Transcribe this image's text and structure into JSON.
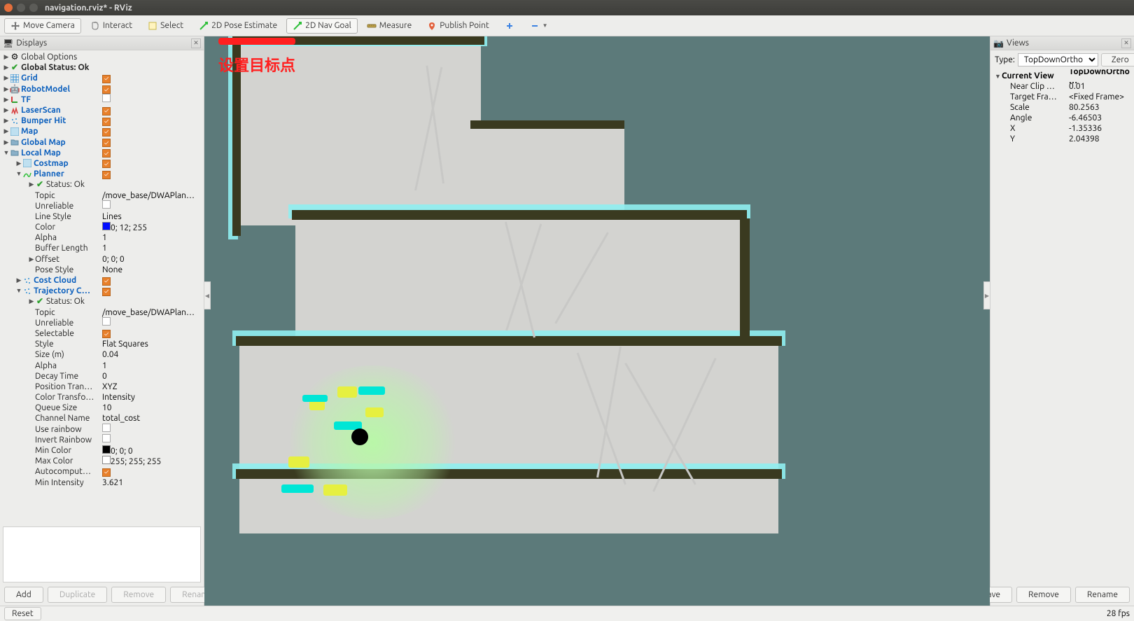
{
  "window": {
    "title": "navigation.rviz* - RViz"
  },
  "toolbar": {
    "move_camera": "Move Camera",
    "interact": "Interact",
    "select": "Select",
    "pose_estimate": "2D Pose Estimate",
    "nav_goal": "2D Nav Goal",
    "measure": "Measure",
    "publish_point": "Publish Point"
  },
  "displays": {
    "title": "Displays",
    "items": {
      "global_options": "Global Options",
      "global_status": "Global Status: Ok",
      "grid": "Grid",
      "robot_model": "RobotModel",
      "tf": "TF",
      "laser_scan": "LaserScan",
      "bumper_hit": "Bumper Hit",
      "map": "Map",
      "global_map": "Global Map",
      "local_map": "Local Map",
      "costmap": "Costmap",
      "planner": "Planner",
      "planner_status": "Status: Ok",
      "planner_topic_k": "Topic",
      "planner_topic_v": "/move_base/DWAPlan…",
      "planner_unreliable_k": "Unreliable",
      "planner_linestyle_k": "Line Style",
      "planner_linestyle_v": "Lines",
      "planner_color_k": "Color",
      "planner_color_v": "0; 12; 255",
      "planner_alpha_k": "Alpha",
      "planner_alpha_v": "1",
      "planner_buflen_k": "Buffer Length",
      "planner_buflen_v": "1",
      "planner_offset_k": "Offset",
      "planner_offset_v": "0; 0; 0",
      "planner_posestyle_k": "Pose Style",
      "planner_posestyle_v": "None",
      "cost_cloud": "Cost Cloud",
      "trajectory_cloud": "Trajectory C…",
      "tc_status": "Status: Ok",
      "tc_topic_k": "Topic",
      "tc_topic_v": "/move_base/DWAPlan…",
      "tc_unreliable_k": "Unreliable",
      "tc_selectable_k": "Selectable",
      "tc_style_k": "Style",
      "tc_style_v": "Flat Squares",
      "tc_size_k": "Size (m)",
      "tc_size_v": "0.04",
      "tc_alpha_k": "Alpha",
      "tc_alpha_v": "1",
      "tc_decay_k": "Decay Time",
      "tc_decay_v": "0",
      "tc_postrans_k": "Position Tran…",
      "tc_postrans_v": "XYZ",
      "tc_coltrans_k": "Color Transfo…",
      "tc_coltrans_v": "Intensity",
      "tc_queue_k": "Queue Size",
      "tc_queue_v": "10",
      "tc_channel_k": "Channel Name",
      "tc_channel_v": "total_cost",
      "tc_rainbow_k": "Use rainbow",
      "tc_invrainbow_k": "Invert Rainbow",
      "tc_mincolor_k": "Min Color",
      "tc_mincolor_v": "0; 0; 0",
      "tc_maxcolor_k": "Max Color",
      "tc_maxcolor_v": "255; 255; 255",
      "tc_autocompute_k": "Autocomput…",
      "tc_minintensity_k": "Min Intensity",
      "tc_minintensity_v": "3.621"
    },
    "buttons": {
      "add": "Add",
      "duplicate": "Duplicate",
      "remove": "Remove",
      "rename": "Rename"
    }
  },
  "viewport": {
    "annotation": "设置目标点"
  },
  "views": {
    "title": "Views",
    "type_label": "Type:",
    "type_value": "TopDownOrtho",
    "zero": "Zero",
    "current_view_k": "Current View",
    "current_view_v": "TopDownOrtho …",
    "near_clip_k": "Near Clip …",
    "near_clip_v": "0.01",
    "target_frame_k": "Target Fra…",
    "target_frame_v": "<Fixed Frame>",
    "scale_k": "Scale",
    "scale_v": "80.2563",
    "angle_k": "Angle",
    "angle_v": "-6.46503",
    "x_k": "X",
    "x_v": "-1.35336",
    "y_k": "Y",
    "y_v": "2.04398",
    "save": "Save",
    "remove": "Remove",
    "rename": "Rename"
  },
  "bottom": {
    "reset": "Reset",
    "fps": "28 fps"
  }
}
